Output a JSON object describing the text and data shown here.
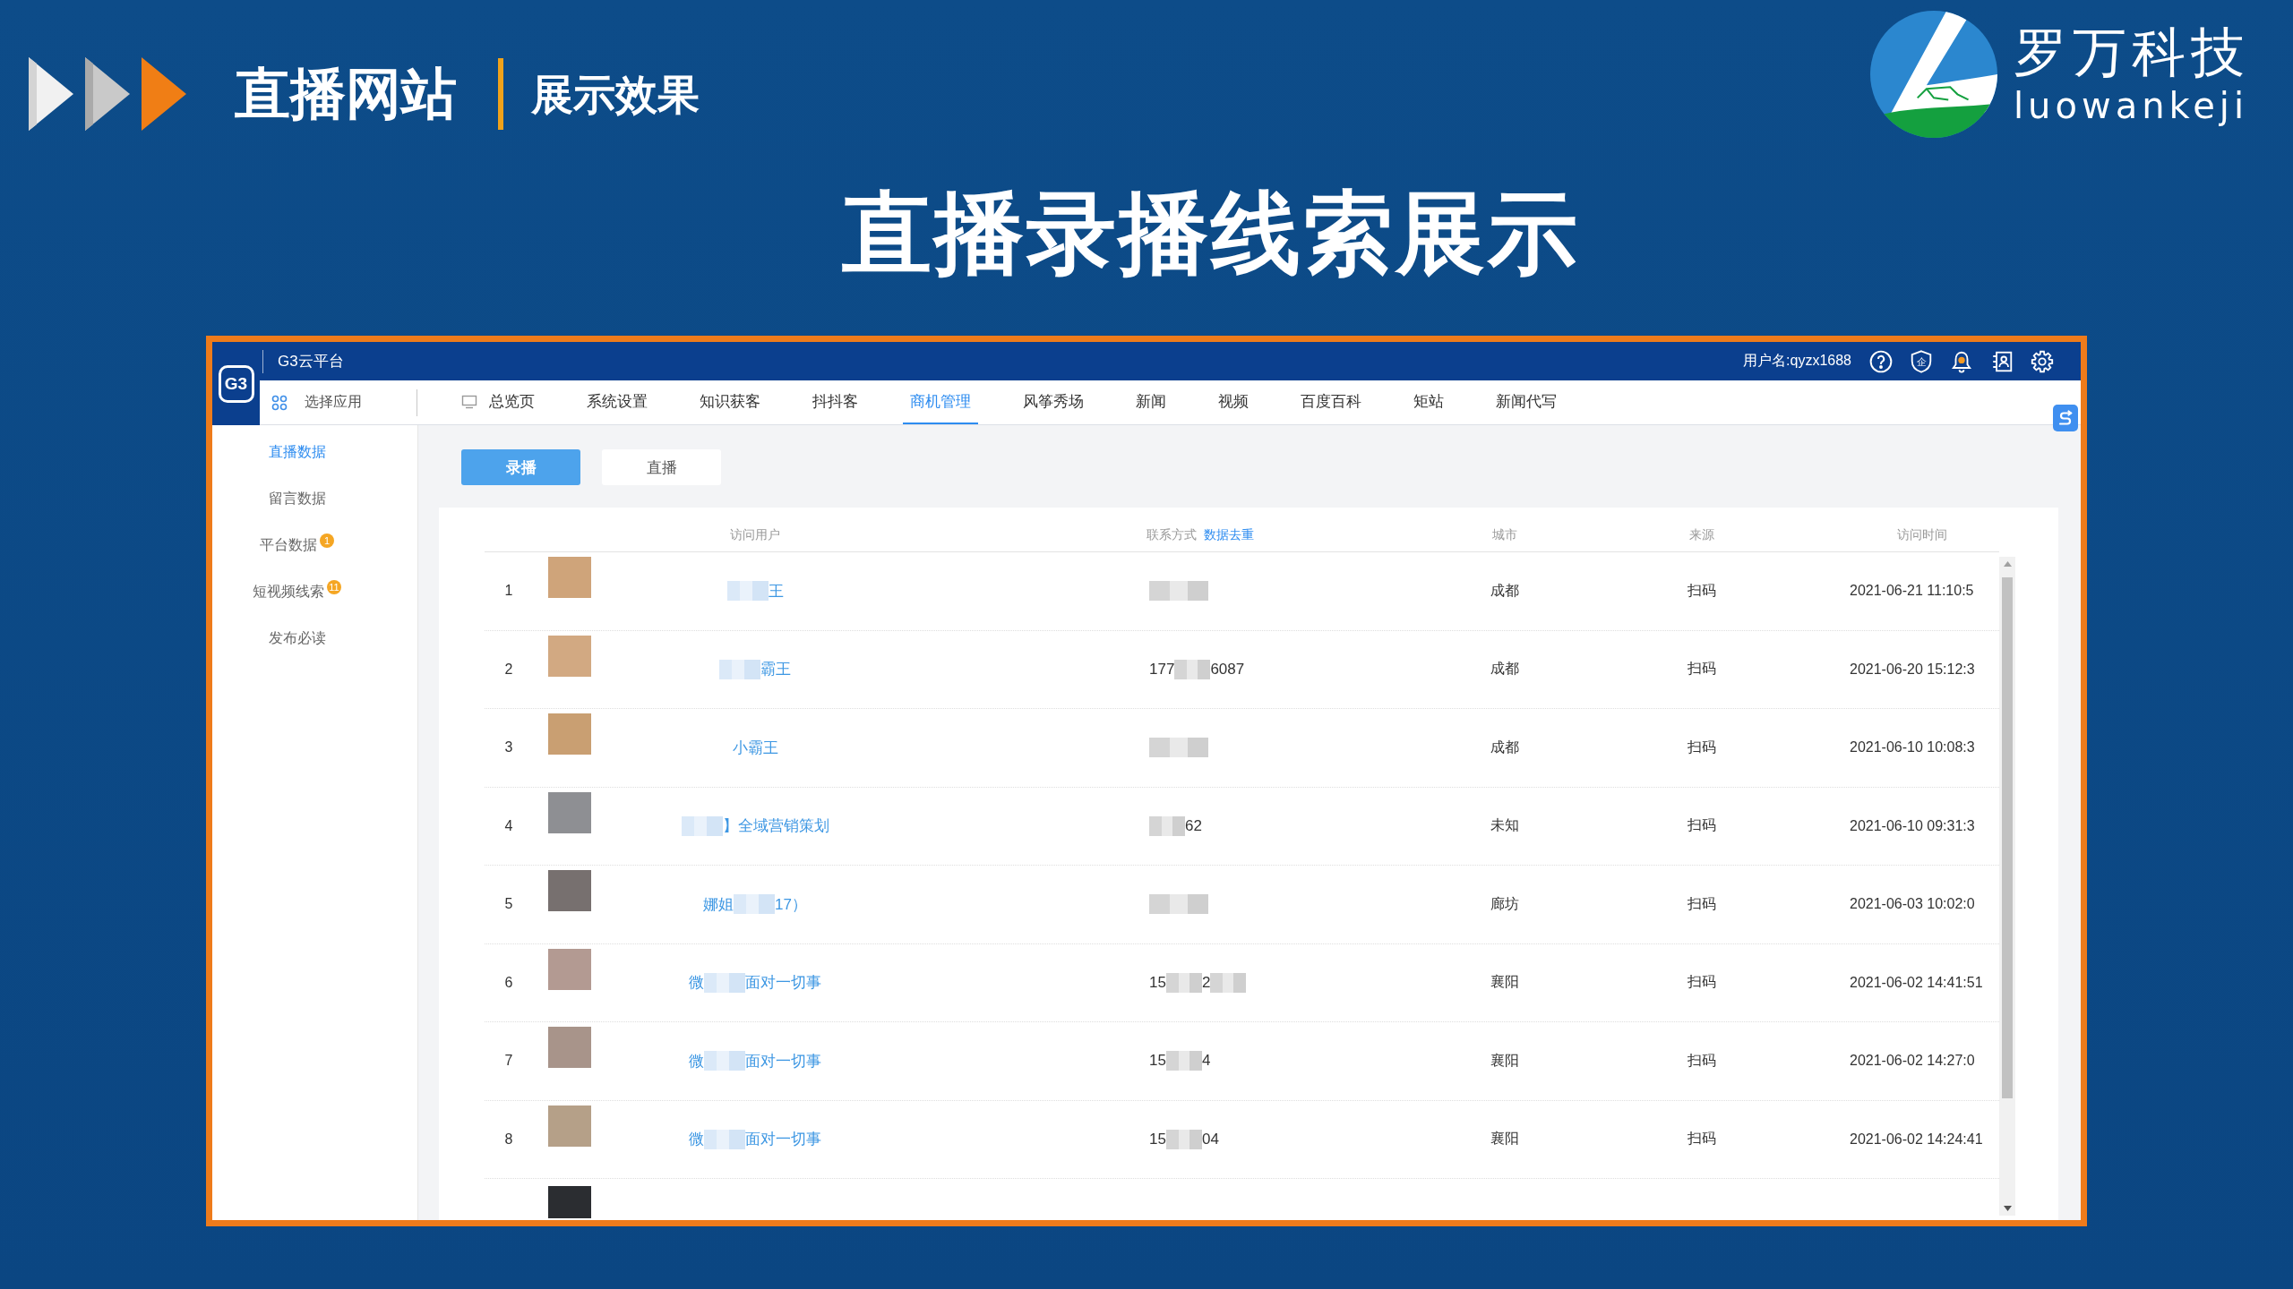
{
  "header": {
    "title": "直播网站",
    "subtitle": "展示效果"
  },
  "brand": {
    "name": "罗万科技",
    "pinyin": "luowankeji"
  },
  "page_title": "直播录播线索展示",
  "app": {
    "logo_text": "G3",
    "platform_name": "G3云平台",
    "username": "用户名:qyzx1688",
    "shield_label": "企",
    "app_selector": "选择应用",
    "tabs": [
      {
        "label": "总览页",
        "kind": "icon",
        "selected": false
      },
      {
        "label": "系统设置",
        "kind": "text",
        "selected": false
      },
      {
        "label": "知识获客",
        "kind": "text",
        "selected": false
      },
      {
        "label": "抖抖客",
        "kind": "text",
        "selected": false
      },
      {
        "label": "商机管理",
        "kind": "text",
        "selected": true
      },
      {
        "label": "风筝秀场",
        "kind": "text",
        "selected": false
      },
      {
        "label": "新闻",
        "kind": "text",
        "selected": false
      },
      {
        "label": "视频",
        "kind": "text",
        "selected": false
      },
      {
        "label": "百度百科",
        "kind": "text",
        "selected": false
      },
      {
        "label": "矩站",
        "kind": "text",
        "selected": false
      },
      {
        "label": "新闻代写",
        "kind": "text",
        "selected": false
      }
    ],
    "sidebar": [
      {
        "label": "直播数据",
        "selected": true
      },
      {
        "label": "留言数据",
        "selected": false
      },
      {
        "label": "平台数据",
        "selected": false,
        "badge": "1"
      },
      {
        "label": "短视频线索",
        "selected": false,
        "badge": "11"
      },
      {
        "label": "发布必读",
        "selected": false
      }
    ],
    "toggle_buttons": [
      {
        "label": "录播",
        "selected": true
      },
      {
        "label": "直播",
        "selected": false
      }
    ],
    "table": {
      "columns": [
        {
          "label": "访问用户"
        },
        {
          "label": "联系方式",
          "link": "数据去重"
        },
        {
          "label": "城市"
        },
        {
          "label": "来源"
        },
        {
          "label": "访问时间"
        }
      ],
      "rows": [
        {
          "kind": "full",
          "index": "1",
          "user": [
            {
              "kind": "redacted"
            },
            {
              "kind": "text",
              "text": "王"
            }
          ],
          "phone": [
            {
              "kind": "redacted"
            }
          ],
          "city": "成都",
          "source": "扫码",
          "time": "2021-06-21 11:10:5"
        },
        {
          "kind": "full",
          "index": "2",
          "user": [
            {
              "kind": "redacted"
            },
            {
              "kind": "text",
              "text": "霸王"
            }
          ],
          "phone": [
            {
              "kind": "text",
              "text": "177"
            },
            {
              "kind": "redacted"
            },
            {
              "kind": "text",
              "text": "6087"
            }
          ],
          "city": "成都",
          "source": "扫码",
          "time": "2021-06-20 15:12:3"
        },
        {
          "kind": "full",
          "index": "3",
          "user": [
            {
              "kind": "text",
              "text": "小霸王"
            }
          ],
          "phone": [
            {
              "kind": "redacted"
            }
          ],
          "city": "成都",
          "source": "扫码",
          "time": "2021-06-10 10:08:3"
        },
        {
          "kind": "full",
          "index": "4",
          "user": [
            {
              "kind": "redacted"
            },
            {
              "kind": "text",
              "text": "】全域营销策划"
            }
          ],
          "phone": [
            {
              "kind": "redacted"
            },
            {
              "kind": "text",
              "text": "62"
            }
          ],
          "city": "未知",
          "source": "扫码",
          "time": "2021-06-10 09:31:3"
        },
        {
          "kind": "full",
          "index": "5",
          "user": [
            {
              "kind": "text",
              "text": "娜姐"
            },
            {
              "kind": "redacted"
            },
            {
              "kind": "text",
              "text": "17）"
            }
          ],
          "phone": [
            {
              "kind": "redacted"
            }
          ],
          "city": "廊坊",
          "source": "扫码",
          "time": "2021-06-03 10:02:0"
        },
        {
          "kind": "full",
          "index": "6",
          "user": [
            {
              "kind": "text",
              "text": "微"
            },
            {
              "kind": "redacted"
            },
            {
              "kind": "text",
              "text": "面对一切事"
            }
          ],
          "phone": [
            {
              "kind": "text",
              "text": "15"
            },
            {
              "kind": "redacted"
            },
            {
              "kind": "text",
              "text": "2"
            },
            {
              "kind": "redacted"
            }
          ],
          "city": "襄阳",
          "source": "扫码",
          "time": "2021-06-02 14:41:51"
        },
        {
          "kind": "full",
          "index": "7",
          "user": [
            {
              "kind": "text",
              "text": "微"
            },
            {
              "kind": "redacted"
            },
            {
              "kind": "text",
              "text": "面对一切事"
            }
          ],
          "phone": [
            {
              "kind": "text",
              "text": "15"
            },
            {
              "kind": "redacted"
            },
            {
              "kind": "text",
              "text": "4"
            }
          ],
          "city": "襄阳",
          "source": "扫码",
          "time": "2021-06-02 14:27:0"
        },
        {
          "kind": "full",
          "index": "8",
          "user": [
            {
              "kind": "text",
              "text": "微"
            },
            {
              "kind": "redacted"
            },
            {
              "kind": "text",
              "text": "面对一切事"
            }
          ],
          "phone": [
            {
              "kind": "text",
              "text": "15"
            },
            {
              "kind": "redacted"
            },
            {
              "kind": "text",
              "text": "04"
            }
          ],
          "city": "襄阳",
          "source": "扫码",
          "time": "2021-06-02 14:24:41"
        },
        {
          "kind": "cut"
        }
      ]
    }
  }
}
